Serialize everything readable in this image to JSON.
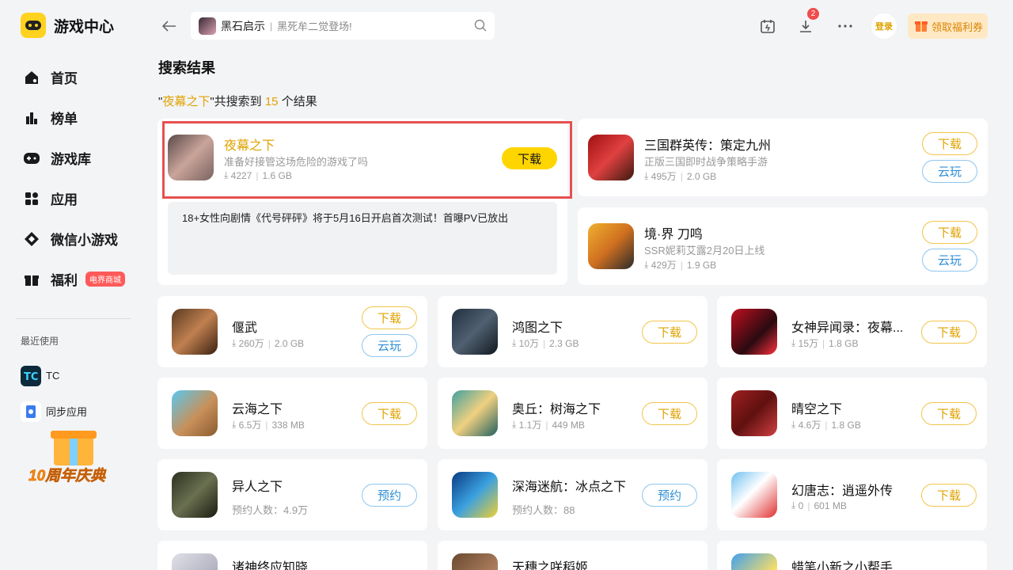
{
  "brand": {
    "title": "游戏中心"
  },
  "nav": [
    {
      "label": "首页",
      "icon": "home-icon"
    },
    {
      "label": "榜单",
      "icon": "chart-icon"
    },
    {
      "label": "游戏库",
      "icon": "gamepad-icon"
    },
    {
      "label": "应用",
      "icon": "apps-icon"
    },
    {
      "label": "微信小游戏",
      "icon": "diamond-icon"
    },
    {
      "label": "福利",
      "icon": "gift-icon",
      "badge": "电界商城"
    }
  ],
  "recent": {
    "title": "最近使用",
    "items": [
      {
        "label": "TC"
      },
      {
        "label": "同步应用"
      }
    ]
  },
  "promo": {
    "text": "10周年庆典"
  },
  "search": {
    "value": "黑石启示",
    "hint": "黑死牟二觉登场!"
  },
  "topbar": {
    "download_badge": "2",
    "login": "登录",
    "coupon": "领取福利券"
  },
  "main": {
    "title": "搜索结果",
    "summary": {
      "q_open": "\"",
      "query": "夜幕之下",
      "mid": "\"共搜索到 ",
      "count": "15",
      "tail": " 个结果"
    }
  },
  "featured": {
    "name": "夜幕之下",
    "desc": "准备好接管这场危险的游戏了吗",
    "downloads": "4227",
    "size": "1.6 GB",
    "button": "下载",
    "news": "18+女性向剧情《代号砰砰》将于5月16日开启首次测试！首曝PV已放出"
  },
  "side_apps": [
    {
      "name": "三国群英传：策定九州",
      "desc": "正版三国即时战争策略手游",
      "downloads": "495万",
      "size": "2.0 GB",
      "btn1": "下载",
      "btn2": "云玩"
    },
    {
      "name": "境·界 刀鸣",
      "desc": "SSR妮莉艾露2月20日上线",
      "downloads": "429万",
      "size": "1.9 GB",
      "btn1": "下载",
      "btn2": "云玩"
    }
  ],
  "grid": [
    {
      "name": "偃武",
      "meta1": "260万",
      "meta2": "2.0 GB",
      "btn1": "下载",
      "btn2": "云玩"
    },
    {
      "name": "鸿图之下",
      "meta1": "10万",
      "meta2": "2.3 GB",
      "btn1": "下载"
    },
    {
      "name": "女神异闻录：夜幕...",
      "meta1": "15万",
      "meta2": "1.8 GB",
      "btn1": "下载"
    },
    {
      "name": "云海之下",
      "meta1": "6.5万",
      "meta2": "338 MB",
      "btn1": "下载"
    },
    {
      "name": "奥丘：树海之下",
      "meta1": "1.1万",
      "meta2": "449 MB",
      "btn1": "下载"
    },
    {
      "name": "晴空之下",
      "meta1": "4.6万",
      "meta2": "1.8 GB",
      "btn1": "下载"
    },
    {
      "name": "异人之下",
      "reserve": "预约人数：4.9万",
      "btn1": "预约"
    },
    {
      "name": "深海迷航：冰点之下",
      "reserve": "预约人数：88",
      "btn1": "预约"
    },
    {
      "name": "幻唐志：逍遥外传",
      "meta1": "0",
      "meta2": "601 MB",
      "btn1": "下载"
    },
    {
      "name": "诸神终应知晓"
    },
    {
      "name": "天穗之咲稻姬"
    },
    {
      "name": "蜡笔小新之小帮手..."
    }
  ]
}
